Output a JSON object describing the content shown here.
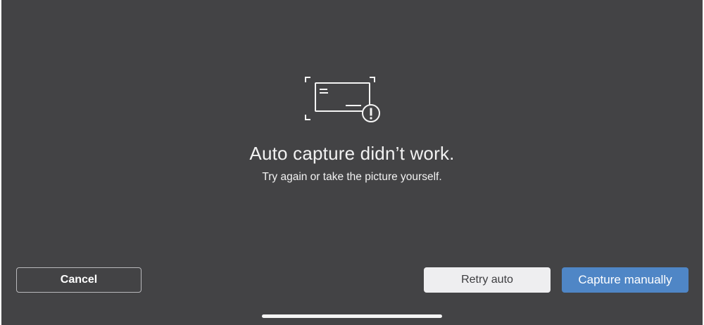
{
  "dialog": {
    "title": "Auto capture didn’t work.",
    "subtitle": "Try again or take the picture yourself.",
    "illustration_icon": "check-capture-warning-icon"
  },
  "actions": {
    "cancel_label": "Cancel",
    "retry_label": "Retry auto",
    "manual_label": "Capture manually"
  },
  "colors": {
    "background": "#434345",
    "primary_button": "#4f86c6",
    "secondary_button": "#eeeef0"
  }
}
